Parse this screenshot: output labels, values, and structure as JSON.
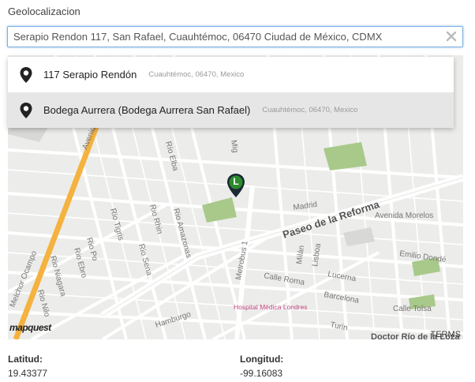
{
  "form": {
    "section_label": "Geolocalizacion",
    "search_value": "Serapio Rendon 117, San Rafael, Cuauhtémoc, 06470 Ciudad de México, CDMX"
  },
  "suggestions": [
    {
      "name": "117 Serapio Rendón",
      "detail": "Cuauhtémoc, 06470, Mexico"
    },
    {
      "name": "Bodega Aurrera (Bodega Aurrera San Rafael)",
      "detail": "Cuauhtémoc, 06470, Mexico"
    }
  ],
  "map": {
    "marker_letter": "L",
    "marker_color": "#2c8b2c",
    "logo": "mapquest",
    "terms": "TERMS",
    "street_labels": [
      "Avenida Ocampo",
      "Melchor Ocampo",
      "Rio Po",
      "Rio Tigris",
      "Rio Rhin",
      "Rio Amazonas",
      "Rio Nilo",
      "Rio Niagara",
      "Rio Ebro",
      "Rio Sena",
      "Río Elba",
      "Paseo de la Reforma",
      "Madrid",
      "Avenida Morelos",
      "Emilio Dondé",
      "Metrobus 1",
      "Milán",
      "Lisboa",
      "Calle Roma",
      "Lucerna",
      "Barcelona",
      "Calle Tolsa",
      "Hamburgo",
      "Turin",
      "Doctor Río de la Loza",
      "Hospital Médica Londres",
      "Mig"
    ]
  },
  "coords": {
    "lat_label": "Latitud:",
    "lat_value": "19.43377",
    "lng_label": "Longitud:",
    "lng_value": "-99.16083"
  }
}
